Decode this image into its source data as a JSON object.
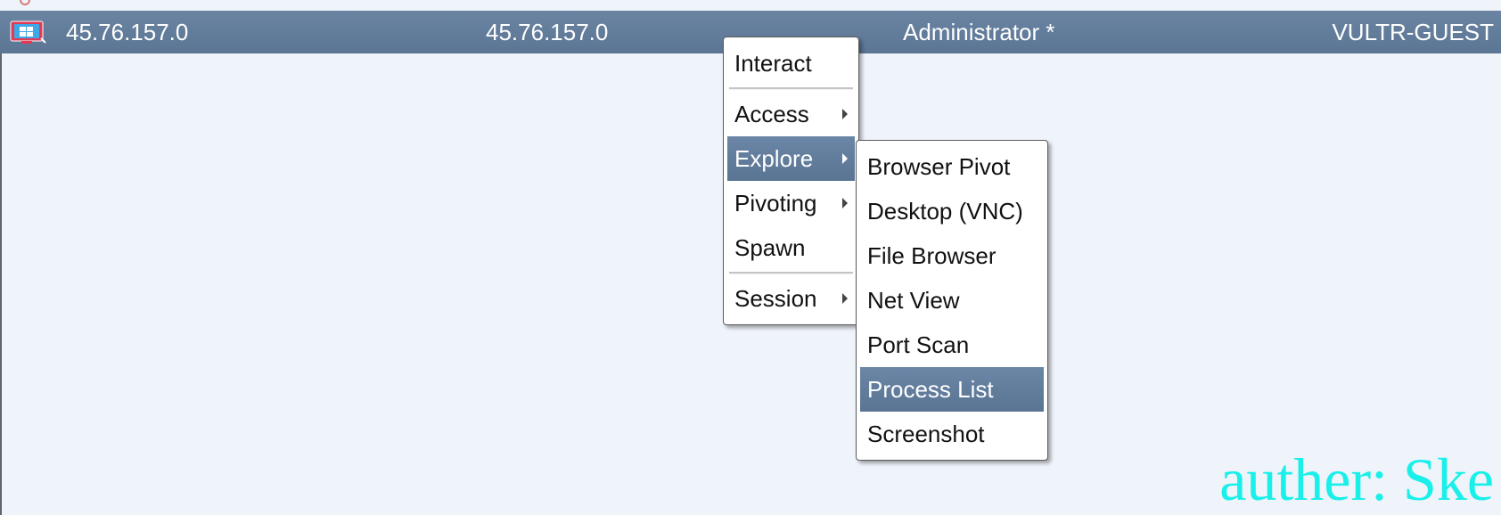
{
  "session_row": {
    "external_ip": "45.76.157.0",
    "internal_ip": "45.76.157.0",
    "user": "Administrator *",
    "computer": "VULTR-GUEST",
    "icon": "windows-beacon-icon"
  },
  "context_menu": {
    "items": [
      {
        "label": "Interact",
        "has_submenu": false
      },
      {
        "label": "Access",
        "has_submenu": true
      },
      {
        "label": "Explore",
        "has_submenu": true,
        "highlighted": true
      },
      {
        "label": "Pivoting",
        "has_submenu": true
      },
      {
        "label": "Spawn",
        "has_submenu": false
      },
      {
        "label": "Session",
        "has_submenu": true
      }
    ]
  },
  "explore_submenu": {
    "items": [
      {
        "label": "Browser Pivot"
      },
      {
        "label": "Desktop (VNC)"
      },
      {
        "label": "File Browser"
      },
      {
        "label": "Net View"
      },
      {
        "label": "Port Scan"
      },
      {
        "label": "Process List",
        "highlighted": true
      },
      {
        "label": "Screenshot"
      }
    ]
  },
  "watermark": "auther: Ske",
  "colors": {
    "row_background": "#5f7896",
    "highlight": "#5f7a99",
    "page_background": "#eff3fa",
    "watermark": "#19f0ea"
  }
}
